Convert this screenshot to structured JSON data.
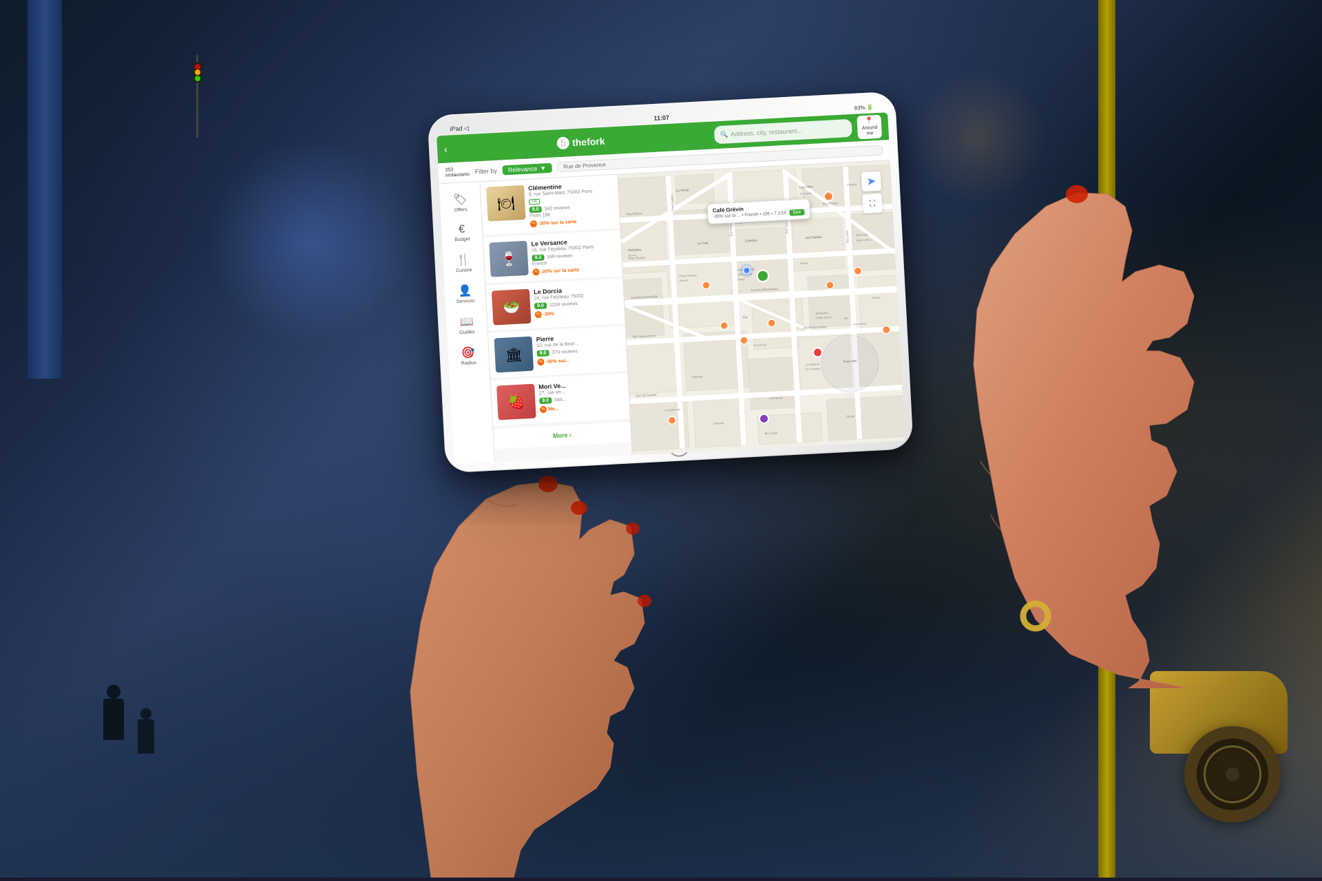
{
  "background": {
    "description": "Night street scene in Paris with wet pavement and bokeh lights"
  },
  "tablet": {
    "status_bar": {
      "left": "iPad ◁",
      "center": "11:07",
      "right": "93% 🔋"
    },
    "header": {
      "back_label": "‹",
      "logo_text": "thefork",
      "search_placeholder": "Address, city, restaurant...",
      "around_me_line1": "Around",
      "around_me_line2": "me"
    },
    "filter_bar": {
      "count": "253",
      "count_sub": "restaurants",
      "filter_by": "Filter by",
      "dropdown_label": "Relevance",
      "address": "Rue de Provence"
    },
    "sidebar": {
      "items": [
        {
          "label": "Offers",
          "icon": "🏷"
        },
        {
          "label": "Budget",
          "icon": "€"
        },
        {
          "label": "Cuisine",
          "icon": "🍴"
        },
        {
          "label": "Services",
          "icon": "👤"
        },
        {
          "label": "Guides",
          "icon": "📖"
        },
        {
          "label": "Radius",
          "icon": "🎯"
        }
      ]
    },
    "restaurants": [
      {
        "name": "Clémentine",
        "address": "5, rue Saint-Marc 75002 Paris",
        "rating": "9.0",
        "reviews": "342 reviews",
        "price": "From 18€",
        "discount": "-30% sur la carte",
        "type": ""
      },
      {
        "name": "Le Versance",
        "address": "16, rue Feydeau 75002 Paris",
        "rating": "9.3",
        "reviews": "169 reviews",
        "price": "French",
        "discount": "-20% sur la carte",
        "type": ""
      },
      {
        "name": "Le Dorcia",
        "address": "24, rue Feydeau 75002",
        "rating": "9.0",
        "reviews": "1209 reviews",
        "price": "",
        "discount": "-30%",
        "type": ""
      },
      {
        "name": "Pierre",
        "address": "10, rue de la Bour...",
        "rating": "8.6",
        "reviews": "370 reviews",
        "price": "",
        "discount": "-40% sur...",
        "type": ""
      },
      {
        "name": "Mori Ve...",
        "address": "27, rue Ve...",
        "rating": "9.0",
        "reviews": "344...",
        "price": "",
        "discount": "Me...",
        "type": ""
      }
    ],
    "more_button": "More ›",
    "map": {
      "popup": {
        "name": "Café Grévin",
        "details": "-30% sur la ... • French • 10€ • 7.1/10",
        "see_label": "See"
      },
      "streets": [
        "Rue Richer",
        "Rue Chodruc",
        "Rue Drouot",
        "Grands Boulevards",
        "Bd Poissonnière",
        "Rue d'Uzès",
        "Rue du Sentier",
        "La Terroir",
        "Les Films",
        "La Tute",
        "CineDoc",
        "Starbucks",
        "Coffee France",
        "La Taverne du Croissant",
        "Saemes",
        "La Cartoche",
        "Paname",
        "Bio C Bon",
        "Senter",
        "Drone Diet",
        "Pichie",
        "Fumaz"
      ]
    }
  }
}
